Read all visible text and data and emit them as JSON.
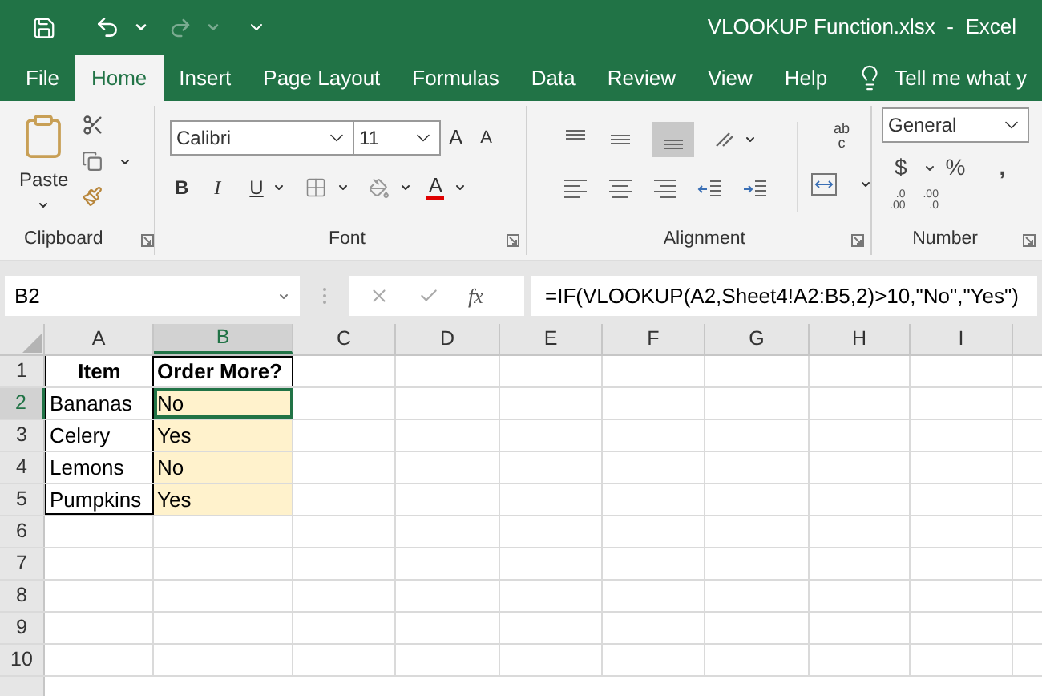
{
  "window": {
    "title": "VLOOKUP Function.xlsx  -  Excel"
  },
  "tabs": [
    {
      "label": "File",
      "selected": false
    },
    {
      "label": "Home",
      "selected": true
    },
    {
      "label": "Insert",
      "selected": false
    },
    {
      "label": "Page Layout",
      "selected": false
    },
    {
      "label": "Formulas",
      "selected": false
    },
    {
      "label": "Data",
      "selected": false
    },
    {
      "label": "Review",
      "selected": false
    },
    {
      "label": "View",
      "selected": false
    },
    {
      "label": "Help",
      "selected": false
    }
  ],
  "tell_me": "Tell me what y",
  "ribbon": {
    "clipboard": {
      "paste": "Paste",
      "label": "Clipboard"
    },
    "font": {
      "name": "Calibri",
      "size": "11",
      "grow": "A",
      "shrink": "A",
      "bold": "B",
      "italic": "I",
      "underline": "U",
      "font_color_letter": "A",
      "label": "Font"
    },
    "alignment": {
      "wrap_top": "ab",
      "wrap_bottom": "c",
      "label": "Alignment"
    },
    "number": {
      "format": "General",
      "currency": "$",
      "percent": "%",
      "comma": ",",
      "decimals": [
        {
          "top": ".0",
          "bottom": ".00"
        },
        {
          "top": ".00",
          "bottom": ".0"
        }
      ],
      "label": "Number"
    }
  },
  "formula_bar": {
    "name_box": "B2",
    "fx": "fx",
    "formula": "=IF(VLOOKUP(A2,Sheet4!A2:B5,2)>10,\"No\",\"Yes\")"
  },
  "columns": [
    {
      "label": "A",
      "selected": false
    },
    {
      "label": "B",
      "selected": true
    },
    {
      "label": "C",
      "selected": false
    },
    {
      "label": "D",
      "selected": false
    },
    {
      "label": "E",
      "selected": false
    },
    {
      "label": "F",
      "selected": false
    },
    {
      "label": "G",
      "selected": false
    },
    {
      "label": "H",
      "selected": false
    },
    {
      "label": "I",
      "selected": false
    }
  ],
  "rows": [
    {
      "header": "1",
      "selected": false,
      "bold": true,
      "cells": [
        {
          "text": "Item",
          "highlighted": false,
          "selected": false
        },
        {
          "text": "Order More?",
          "highlighted": false,
          "selected": false
        }
      ]
    },
    {
      "header": "2",
      "selected": true,
      "bold": false,
      "cells": [
        {
          "text": "Bananas",
          "highlighted": false,
          "selected": false
        },
        {
          "text": "No",
          "highlighted": true,
          "selected": true
        }
      ]
    },
    {
      "header": "3",
      "selected": false,
      "bold": false,
      "cells": [
        {
          "text": "Celery",
          "highlighted": false,
          "selected": false
        },
        {
          "text": "Yes",
          "highlighted": true,
          "selected": false
        }
      ]
    },
    {
      "header": "4",
      "selected": false,
      "bold": false,
      "cells": [
        {
          "text": "Lemons",
          "highlighted": false,
          "selected": false
        },
        {
          "text": "No",
          "highlighted": true,
          "selected": false
        }
      ]
    },
    {
      "header": "5",
      "selected": false,
      "bold": false,
      "cells": [
        {
          "text": "Pumpkins",
          "highlighted": false,
          "selected": false
        },
        {
          "text": "Yes",
          "highlighted": true,
          "selected": false
        }
      ]
    },
    {
      "header": "6",
      "selected": false,
      "cells": []
    },
    {
      "header": "7",
      "selected": false,
      "cells": []
    },
    {
      "header": "8",
      "selected": false,
      "cells": []
    },
    {
      "header": "9",
      "selected": false,
      "cells": []
    },
    {
      "header": "10",
      "selected": false,
      "cells": []
    }
  ]
}
